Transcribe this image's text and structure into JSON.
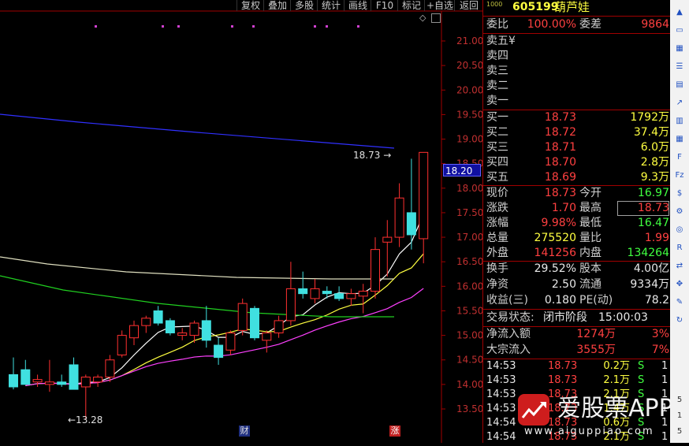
{
  "toolbar": {
    "buttons": [
      "复权",
      "叠加",
      "多股",
      "统计",
      "画线",
      "F10",
      "标记",
      "+自选",
      "返回"
    ]
  },
  "chart": {
    "price_axis": [
      "21.00",
      "20.50",
      "20.00",
      "19.50",
      "19.00",
      "18.50",
      "18.00",
      "17.50",
      "17.00",
      "16.50",
      "16.00",
      "15.50",
      "15.00",
      "14.50",
      "14.00",
      "13.50"
    ],
    "current_price_tag": "18.20",
    "high_annotation": "18.73",
    "low_annotation": "←13.28",
    "event_markers": [
      "财",
      "涨"
    ]
  },
  "chart_data": {
    "type": "candlestick",
    "ylim": [
      13.2,
      21.2
    ],
    "candles": [
      {
        "o": 14.2,
        "h": 14.55,
        "l": 13.9,
        "c": 13.95
      },
      {
        "o": 14.3,
        "h": 14.5,
        "l": 14.0,
        "c": 14.0
      },
      {
        "o": 14.05,
        "h": 14.2,
        "l": 13.95,
        "c": 14.1
      },
      {
        "o": 14.0,
        "h": 14.5,
        "l": 13.85,
        "c": 14.05
      },
      {
        "o": 14.05,
        "h": 14.2,
        "l": 13.95,
        "c": 14.0
      },
      {
        "o": 14.4,
        "h": 14.55,
        "l": 13.9,
        "c": 13.9
      },
      {
        "o": 13.95,
        "h": 14.2,
        "l": 13.28,
        "c": 14.15
      },
      {
        "o": 14.05,
        "h": 14.2,
        "l": 13.95,
        "c": 14.15
      },
      {
        "o": 14.15,
        "h": 14.6,
        "l": 14.05,
        "c": 14.5
      },
      {
        "o": 14.6,
        "h": 15.1,
        "l": 14.55,
        "c": 15.0
      },
      {
        "o": 14.95,
        "h": 15.3,
        "l": 14.8,
        "c": 15.2
      },
      {
        "o": 15.2,
        "h": 15.4,
        "l": 15.05,
        "c": 15.35
      },
      {
        "o": 15.5,
        "h": 15.6,
        "l": 15.2,
        "c": 15.25
      },
      {
        "o": 15.3,
        "h": 15.35,
        "l": 15.0,
        "c": 15.05
      },
      {
        "o": 15.0,
        "h": 15.15,
        "l": 14.9,
        "c": 15.05
      },
      {
        "o": 15.0,
        "h": 15.3,
        "l": 14.85,
        "c": 15.25
      },
      {
        "o": 15.3,
        "h": 15.6,
        "l": 14.75,
        "c": 14.9
      },
      {
        "o": 14.8,
        "h": 14.95,
        "l": 14.4,
        "c": 14.55
      },
      {
        "o": 14.7,
        "h": 15.1,
        "l": 14.6,
        "c": 15.05
      },
      {
        "o": 15.1,
        "h": 15.75,
        "l": 15.0,
        "c": 15.65
      },
      {
        "o": 15.55,
        "h": 15.6,
        "l": 14.9,
        "c": 14.95
      },
      {
        "o": 14.9,
        "h": 15.1,
        "l": 14.65,
        "c": 15.05
      },
      {
        "o": 15.05,
        "h": 15.4,
        "l": 14.95,
        "c": 15.3
      },
      {
        "o": 15.3,
        "h": 16.5,
        "l": 15.2,
        "c": 15.95
      },
      {
        "o": 15.95,
        "h": 16.3,
        "l": 15.75,
        "c": 15.85
      },
      {
        "o": 15.75,
        "h": 16.15,
        "l": 15.65,
        "c": 15.95
      },
      {
        "o": 15.9,
        "h": 16.0,
        "l": 15.75,
        "c": 15.85
      },
      {
        "o": 15.85,
        "h": 16.0,
        "l": 15.7,
        "c": 15.75
      },
      {
        "o": 15.75,
        "h": 15.95,
        "l": 15.6,
        "c": 15.85
      },
      {
        "o": 15.8,
        "h": 16.05,
        "l": 15.45,
        "c": 15.9
      },
      {
        "o": 15.9,
        "h": 17.0,
        "l": 15.75,
        "c": 16.75
      },
      {
        "o": 16.9,
        "h": 17.35,
        "l": 16.2,
        "c": 17.0
      },
      {
        "o": 17.0,
        "h": 18.1,
        "l": 16.8,
        "c": 17.8
      },
      {
        "o": 17.5,
        "h": 18.6,
        "l": 16.75,
        "c": 17.05
      },
      {
        "o": 16.97,
        "h": 18.73,
        "l": 16.47,
        "c": 18.73
      }
    ]
  },
  "quote": {
    "code": "605199",
    "name": "葫芦娃",
    "weibi_label": "委比",
    "weibi": "100.00%",
    "weicha_label": "委差",
    "weicha": "9864",
    "asks": [
      {
        "label": "卖五¥",
        "price": "",
        "vol": ""
      },
      {
        "label": "卖四",
        "price": "",
        "vol": ""
      },
      {
        "label": "卖三",
        "price": "",
        "vol": ""
      },
      {
        "label": "卖二",
        "price": "",
        "vol": ""
      },
      {
        "label": "卖一",
        "price": "",
        "vol": ""
      }
    ],
    "bids": [
      {
        "label": "买一",
        "price": "18.73",
        "vol": "1792万"
      },
      {
        "label": "买二",
        "price": "18.72",
        "vol": "37.4万"
      },
      {
        "label": "买三",
        "price": "18.71",
        "vol": "6.0万"
      },
      {
        "label": "买四",
        "price": "18.70",
        "vol": "2.8万"
      },
      {
        "label": "买五",
        "price": "18.69",
        "vol": "9.3万"
      }
    ],
    "stats": [
      {
        "l1": "现价",
        "v1": "18.73",
        "c1": "red",
        "l2": "今开",
        "v2": "16.97",
        "c2": "grn"
      },
      {
        "l1": "涨跌",
        "v1": "1.70",
        "c1": "red",
        "l2": "最高",
        "v2": "18.73",
        "c2": "red"
      },
      {
        "l1": "涨幅",
        "v1": "9.98%",
        "c1": "red",
        "l2": "最低",
        "v2": "16.47",
        "c2": "grn"
      },
      {
        "l1": "总量",
        "v1": "275520",
        "c1": "yel",
        "l2": "量比",
        "v2": "1.99",
        "c2": "red"
      },
      {
        "l1": "外盘",
        "v1": "141256",
        "c1": "red",
        "l2": "内盘",
        "v2": "134264",
        "c2": "grn"
      }
    ],
    "fund": [
      {
        "l1": "换手",
        "v1": "29.52%",
        "l2": "股本",
        "v2": "4.00亿"
      },
      {
        "l1": "净资",
        "v1": "2.50",
        "l2": "流通",
        "v2": "9334万"
      },
      {
        "l1": "收益(三)",
        "v1": "0.180",
        "l2": "PE(动)",
        "v2": "78.2"
      }
    ],
    "trade_status_label": "交易状态:",
    "trade_status": "闭市阶段",
    "trade_time": "15:00:03",
    "flows": [
      {
        "label": "净流入额",
        "value": "1274万",
        "pct": "3%"
      },
      {
        "label": "大宗流入",
        "value": "3555万",
        "pct": "7%"
      }
    ],
    "ticks": [
      {
        "time": "14:53",
        "price": "18.73",
        "vol": "0.2万",
        "side": "S",
        "n": "1"
      },
      {
        "time": "14:53",
        "price": "18.73",
        "vol": "2.1万",
        "side": "S",
        "n": "1"
      },
      {
        "time": "14:53",
        "price": "18.73",
        "vol": "2.1万",
        "side": "S",
        "n": "1"
      },
      {
        "time": "14:53",
        "price": "18.73",
        "vol": "1.4万",
        "side": "S",
        "n": "1"
      },
      {
        "time": "14:54",
        "price": "18.73",
        "vol": "0.6万",
        "side": "S",
        "n": "1"
      },
      {
        "time": "14:54",
        "price": "18.73",
        "vol": "2.1万",
        "side": "S",
        "n": "1"
      }
    ]
  },
  "watermark": {
    "brand": "爱股票APP",
    "url": "www.aiguppiao.com"
  },
  "sidebar_icons": [
    "up-arrow-icon",
    "monitor-icon",
    "grid-icon",
    "list-icon",
    "table-icon",
    "line-chart-icon",
    "candle-icon",
    "table2-icon",
    "f10-icon",
    "fiz-icon",
    "dollar-icon",
    "settings-icon",
    "zoom-icon",
    "rsi-icon",
    "pair-icon",
    "move-icon",
    "pencil-icon",
    "refresh-icon"
  ]
}
